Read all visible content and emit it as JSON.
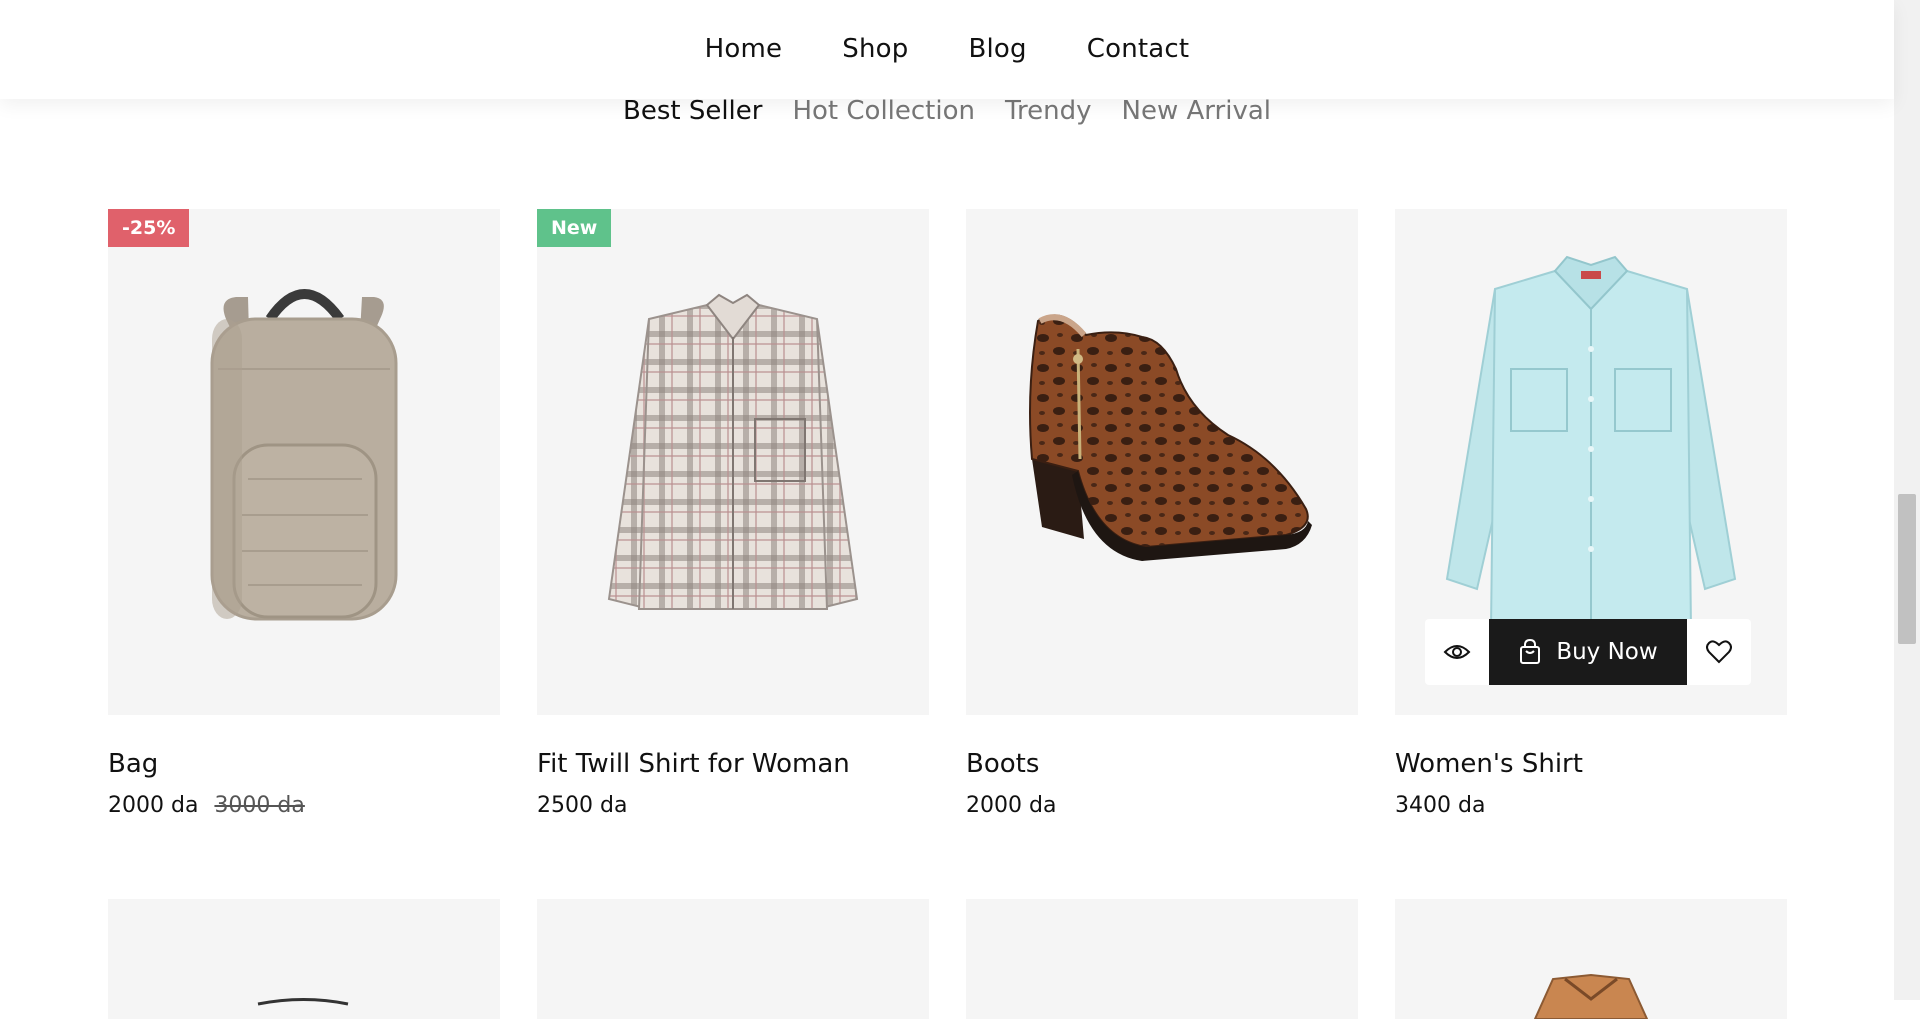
{
  "nav": {
    "items": [
      "Home",
      "Shop",
      "Blog",
      "Contact"
    ]
  },
  "tabs": {
    "items": [
      "Best Seller",
      "Hot Collection",
      "Trendy",
      "New Arrival"
    ],
    "active": "Best Seller"
  },
  "products": [
    {
      "title": "Bag",
      "price": "2000 da",
      "old_price": "3000 da",
      "badge": "-25%",
      "badge_color": "#e0616b",
      "image": "backpack"
    },
    {
      "title": "Fit Twill Shirt for Woman",
      "price": "2500 da",
      "badge": "New",
      "badge_color": "#5fc28b",
      "image": "plaid-shirt"
    },
    {
      "title": "Boots",
      "price": "2000 da",
      "image": "leopard-boot"
    },
    {
      "title": "Women's Shirt",
      "price": "3400 da",
      "image": "light-blue-shirt"
    }
  ],
  "product_actions": {
    "buy_label": "Buy Now",
    "icons": [
      "eye-icon",
      "shopping-bag-icon",
      "heart-icon"
    ]
  },
  "colors": {
    "card_bg": "#f5f5f5",
    "buy_button_bg": "#1a1a1a",
    "badge_sale": "#e0616b",
    "badge_new": "#5fc28b",
    "tab_inactive": "#777777"
  }
}
